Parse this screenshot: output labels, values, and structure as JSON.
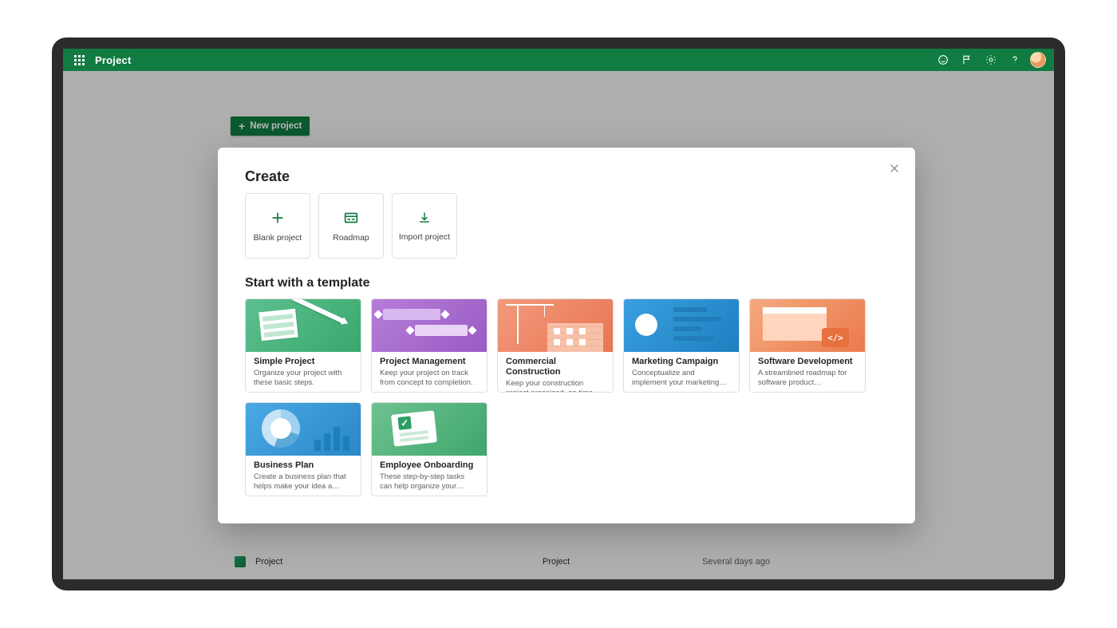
{
  "header": {
    "app_name": "Project"
  },
  "page": {
    "new_project_label": "New project",
    "recent_row": {
      "name": "Project",
      "type": "Project",
      "time": "Several days ago"
    }
  },
  "modal": {
    "create_heading": "Create",
    "template_heading": "Start with a template",
    "create_options": {
      "blank": "Blank project",
      "roadmap": "Roadmap",
      "import": "Import project"
    },
    "templates": [
      {
        "title": "Simple Project",
        "desc": "Organize your project with these basic steps."
      },
      {
        "title": "Project Management",
        "desc": "Keep your project on track from concept to completion."
      },
      {
        "title": "Commercial Construction",
        "desc": "Keep your construction project organized, on time, and on..."
      },
      {
        "title": "Marketing Campaign",
        "desc": "Conceptualize and implement your marketing campaign."
      },
      {
        "title": "Software Development",
        "desc": "A streamlined roadmap for software product development."
      },
      {
        "title": "Business Plan",
        "desc": "Create a business plan that helps make your idea a reality."
      },
      {
        "title": "Employee Onboarding",
        "desc": "These step-by-step tasks can help organize your employee..."
      }
    ]
  }
}
